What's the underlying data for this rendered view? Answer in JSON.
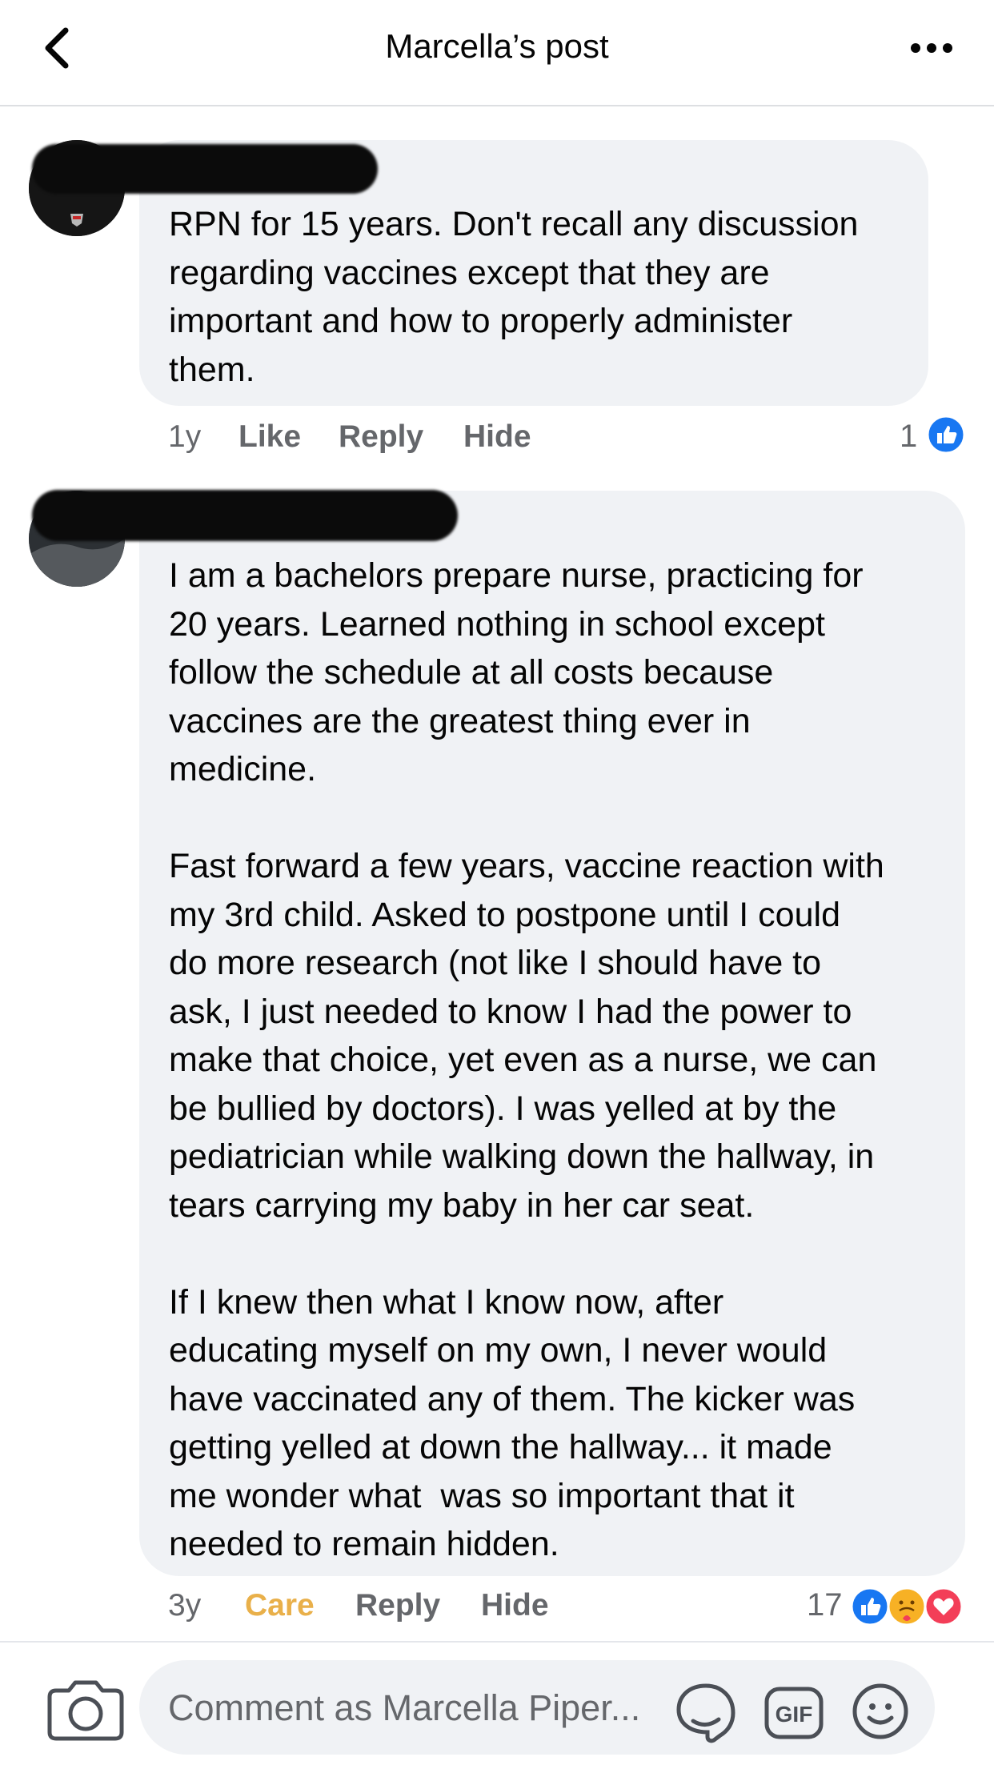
{
  "header": {
    "title": "Marcella’s post"
  },
  "comments": [
    {
      "text": "RPN for 15 years. Don't recall any discussion\nregarding vaccines except that they are\nimportant and how to properly administer\nthem.",
      "time": "1y",
      "actions": [
        "Like",
        "Reply",
        "Hide"
      ],
      "reaction_count": "1",
      "reactions": [
        "like-icon"
      ]
    },
    {
      "text": "I am a bachelors prepare nurse, practicing for\n20 years. Learned nothing in school except\nfollow the schedule at all costs because\nvaccines are the greatest thing ever in\nmedicine.\n\nFast forward a few years, vaccine reaction with\nmy 3rd child. Asked to postpone until I could\ndo more research (not like I should have to\nask, I just needed to know I had the power to\nmake that choice, yet even as a nurse, we can\nbe bullied by doctors). I was yelled at by the\npediatrician while walking down the hallway, in\ntears carrying my baby in her car seat.\n\nIf I knew then what I know now, after\neducating myself on my own, I never would\nhave vaccinated any of them. The kicker was\ngetting yelled at down the hallway... it made\nme wonder what  was so important that it\nneeded to remain hidden.",
      "time": "3y",
      "actions": [
        "Care",
        "Reply",
        "Hide"
      ],
      "reaction_count": "17",
      "reactions": [
        "like-icon",
        "care-icon",
        "love-icon"
      ]
    }
  ],
  "composer": {
    "placeholder": "Comment as Marcella Piper..."
  },
  "colors": {
    "bubble": "#f0f2f5",
    "like_blue": "#1877f2",
    "love_red": "#f33e58",
    "care_yellow": "#e9b04a",
    "secondary_text": "#65676b"
  }
}
